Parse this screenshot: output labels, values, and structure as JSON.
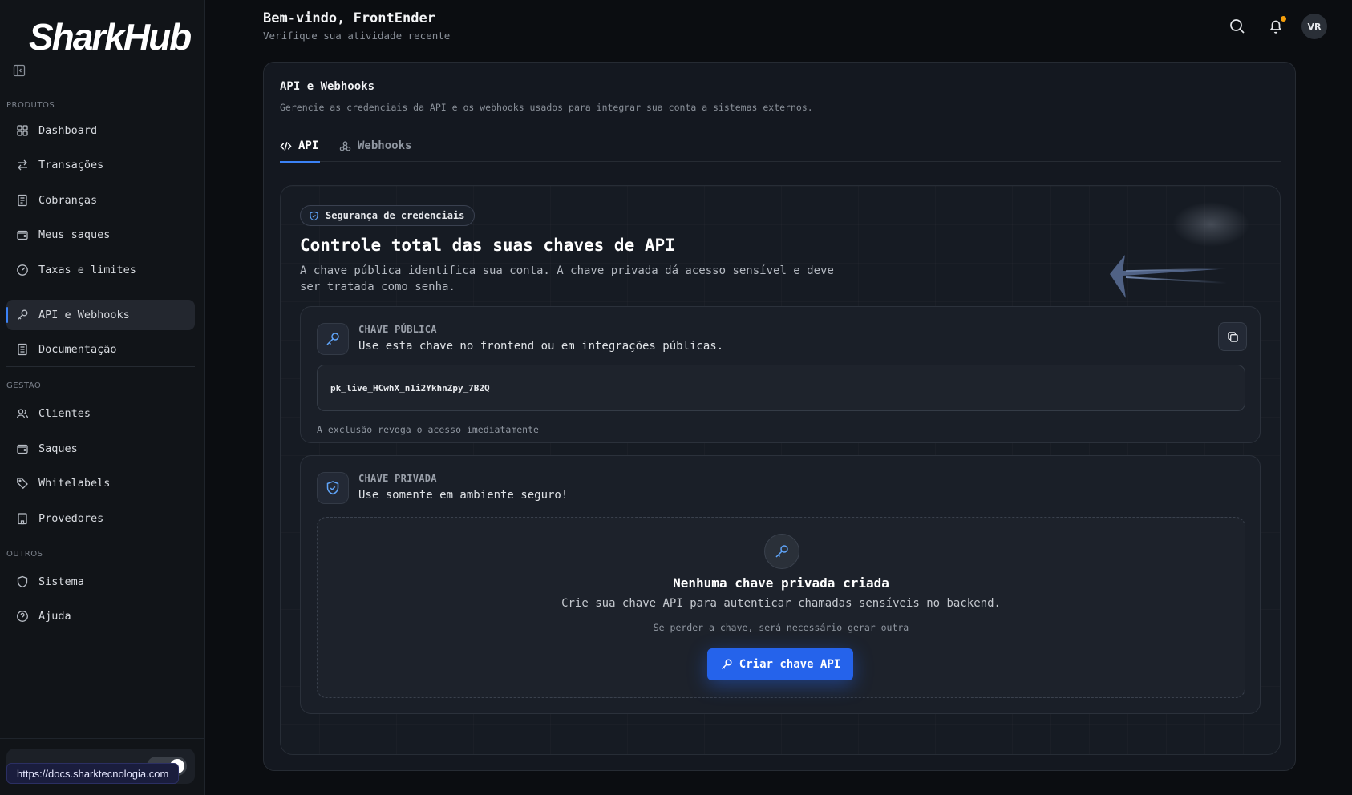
{
  "sidebar": {
    "logo_text": "SharkHub",
    "sections": [
      {
        "label": "PRODUTOS",
        "items": [
          {
            "label": "Dashboard",
            "icon": "grid-icon"
          },
          {
            "label": "Transações",
            "icon": "arrows-exchange-icon"
          },
          {
            "label": "Cobranças",
            "icon": "receipt-icon"
          },
          {
            "label": "Meus saques",
            "icon": "wallet-icon"
          },
          {
            "label": "Taxas e limites",
            "icon": "gauge-icon"
          },
          {
            "label": "API e Webhooks",
            "icon": "key-icon",
            "active": true
          },
          {
            "label": "Documentação",
            "icon": "document-icon"
          }
        ]
      },
      {
        "label": "GESTÃO",
        "items": [
          {
            "label": "Clientes",
            "icon": "users-icon"
          },
          {
            "label": "Saques",
            "icon": "wallet-icon"
          },
          {
            "label": "Whitelabels",
            "icon": "tag-icon"
          },
          {
            "label": "Provedores",
            "icon": "building-icon"
          }
        ]
      },
      {
        "label": "OUTROS",
        "items": [
          {
            "label": "Sistema",
            "icon": "shield-icon"
          },
          {
            "label": "Ajuda",
            "icon": "help-circle-icon"
          }
        ]
      }
    ],
    "status_url": "https://docs.sharktecnologia.com"
  },
  "header": {
    "title": "Bem-vindo, FrontEnder",
    "subtitle": "Verifique sua atividade recente",
    "avatar_initials": "VR",
    "notification_dot_color": "#f59e0b"
  },
  "panel": {
    "title": "API e Webhooks",
    "subtitle": "Gerencie as credenciais da API e os webhooks usados para integrar sua conta a sistemas externos.",
    "tabs": [
      {
        "label": "API",
        "icon": "code-icon",
        "active": true
      },
      {
        "label": "Webhooks",
        "icon": "webhook-icon",
        "active": false
      }
    ]
  },
  "card": {
    "badge": "Segurança de credenciais",
    "title": "Controle total das suas chaves de API",
    "description": "A chave pública identifica sua conta. A chave privada dá acesso sensível e deve ser tratada como senha.",
    "public_key": {
      "label": "CHAVE PÚBLICA",
      "description": "Use esta chave no frontend ou em integrações públicas.",
      "value": "pk_live_HCwhX_n1i2YkhnZpy_7B2Q",
      "note": "A exclusão revoga o acesso imediatamente"
    },
    "private_key": {
      "label": "CHAVE PRIVADA",
      "description": "Use somente em ambiente seguro!",
      "empty_title": "Nenhuma chave privada criada",
      "empty_description": "Crie sua chave API para autenticar chamadas sensíveis no backend.",
      "empty_note": "Se perder a chave, será necessário gerar outra",
      "create_button": "Criar chave API"
    }
  },
  "colors": {
    "accent": "#3b82f6",
    "button": "#2563eb",
    "background": "#0b0d11"
  }
}
